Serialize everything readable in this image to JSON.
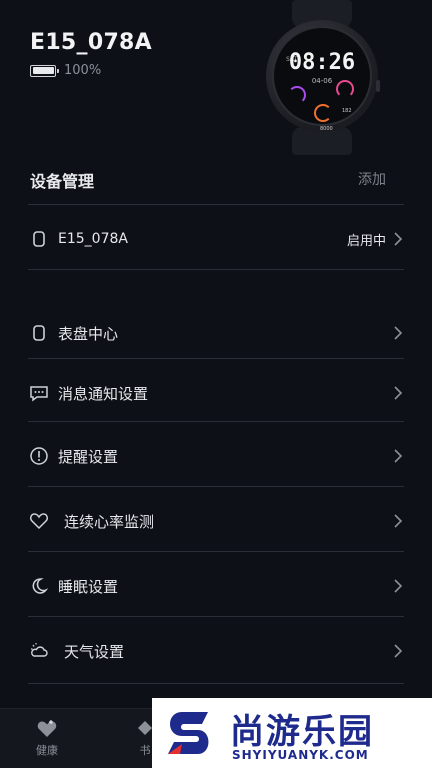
{
  "device": {
    "name": "E15_078A",
    "battery_percent": "100%"
  },
  "watch_face": {
    "time": "08:26",
    "date": "04-06",
    "day": "SAT",
    "stat_1": "182",
    "stat_2": "8000"
  },
  "section": {
    "title": "设备管理",
    "add_label": "添加"
  },
  "device_row": {
    "icon": "watch-icon",
    "label": "E15_078A",
    "status": "启用中"
  },
  "menu": [
    {
      "icon": "watch-face-icon",
      "label": "表盘中心"
    },
    {
      "icon": "message-icon",
      "label": "消息通知设置"
    },
    {
      "icon": "alert-icon",
      "label": "提醒设置"
    },
    {
      "icon": "heart-icon",
      "label": "连续心率监测"
    },
    {
      "icon": "moon-icon",
      "label": "睡眠设置"
    },
    {
      "icon": "weather-icon",
      "label": "天气设置"
    }
  ],
  "bottom_nav": {
    "health_label": "健康",
    "second_label": "书"
  },
  "watermark": {
    "title": "尚游乐园",
    "url": "SHYIYUANYK.COM"
  },
  "colors": {
    "background": "#0d1016",
    "divider": "#2a2e36",
    "watermark_blue": "#1e2a8c"
  }
}
